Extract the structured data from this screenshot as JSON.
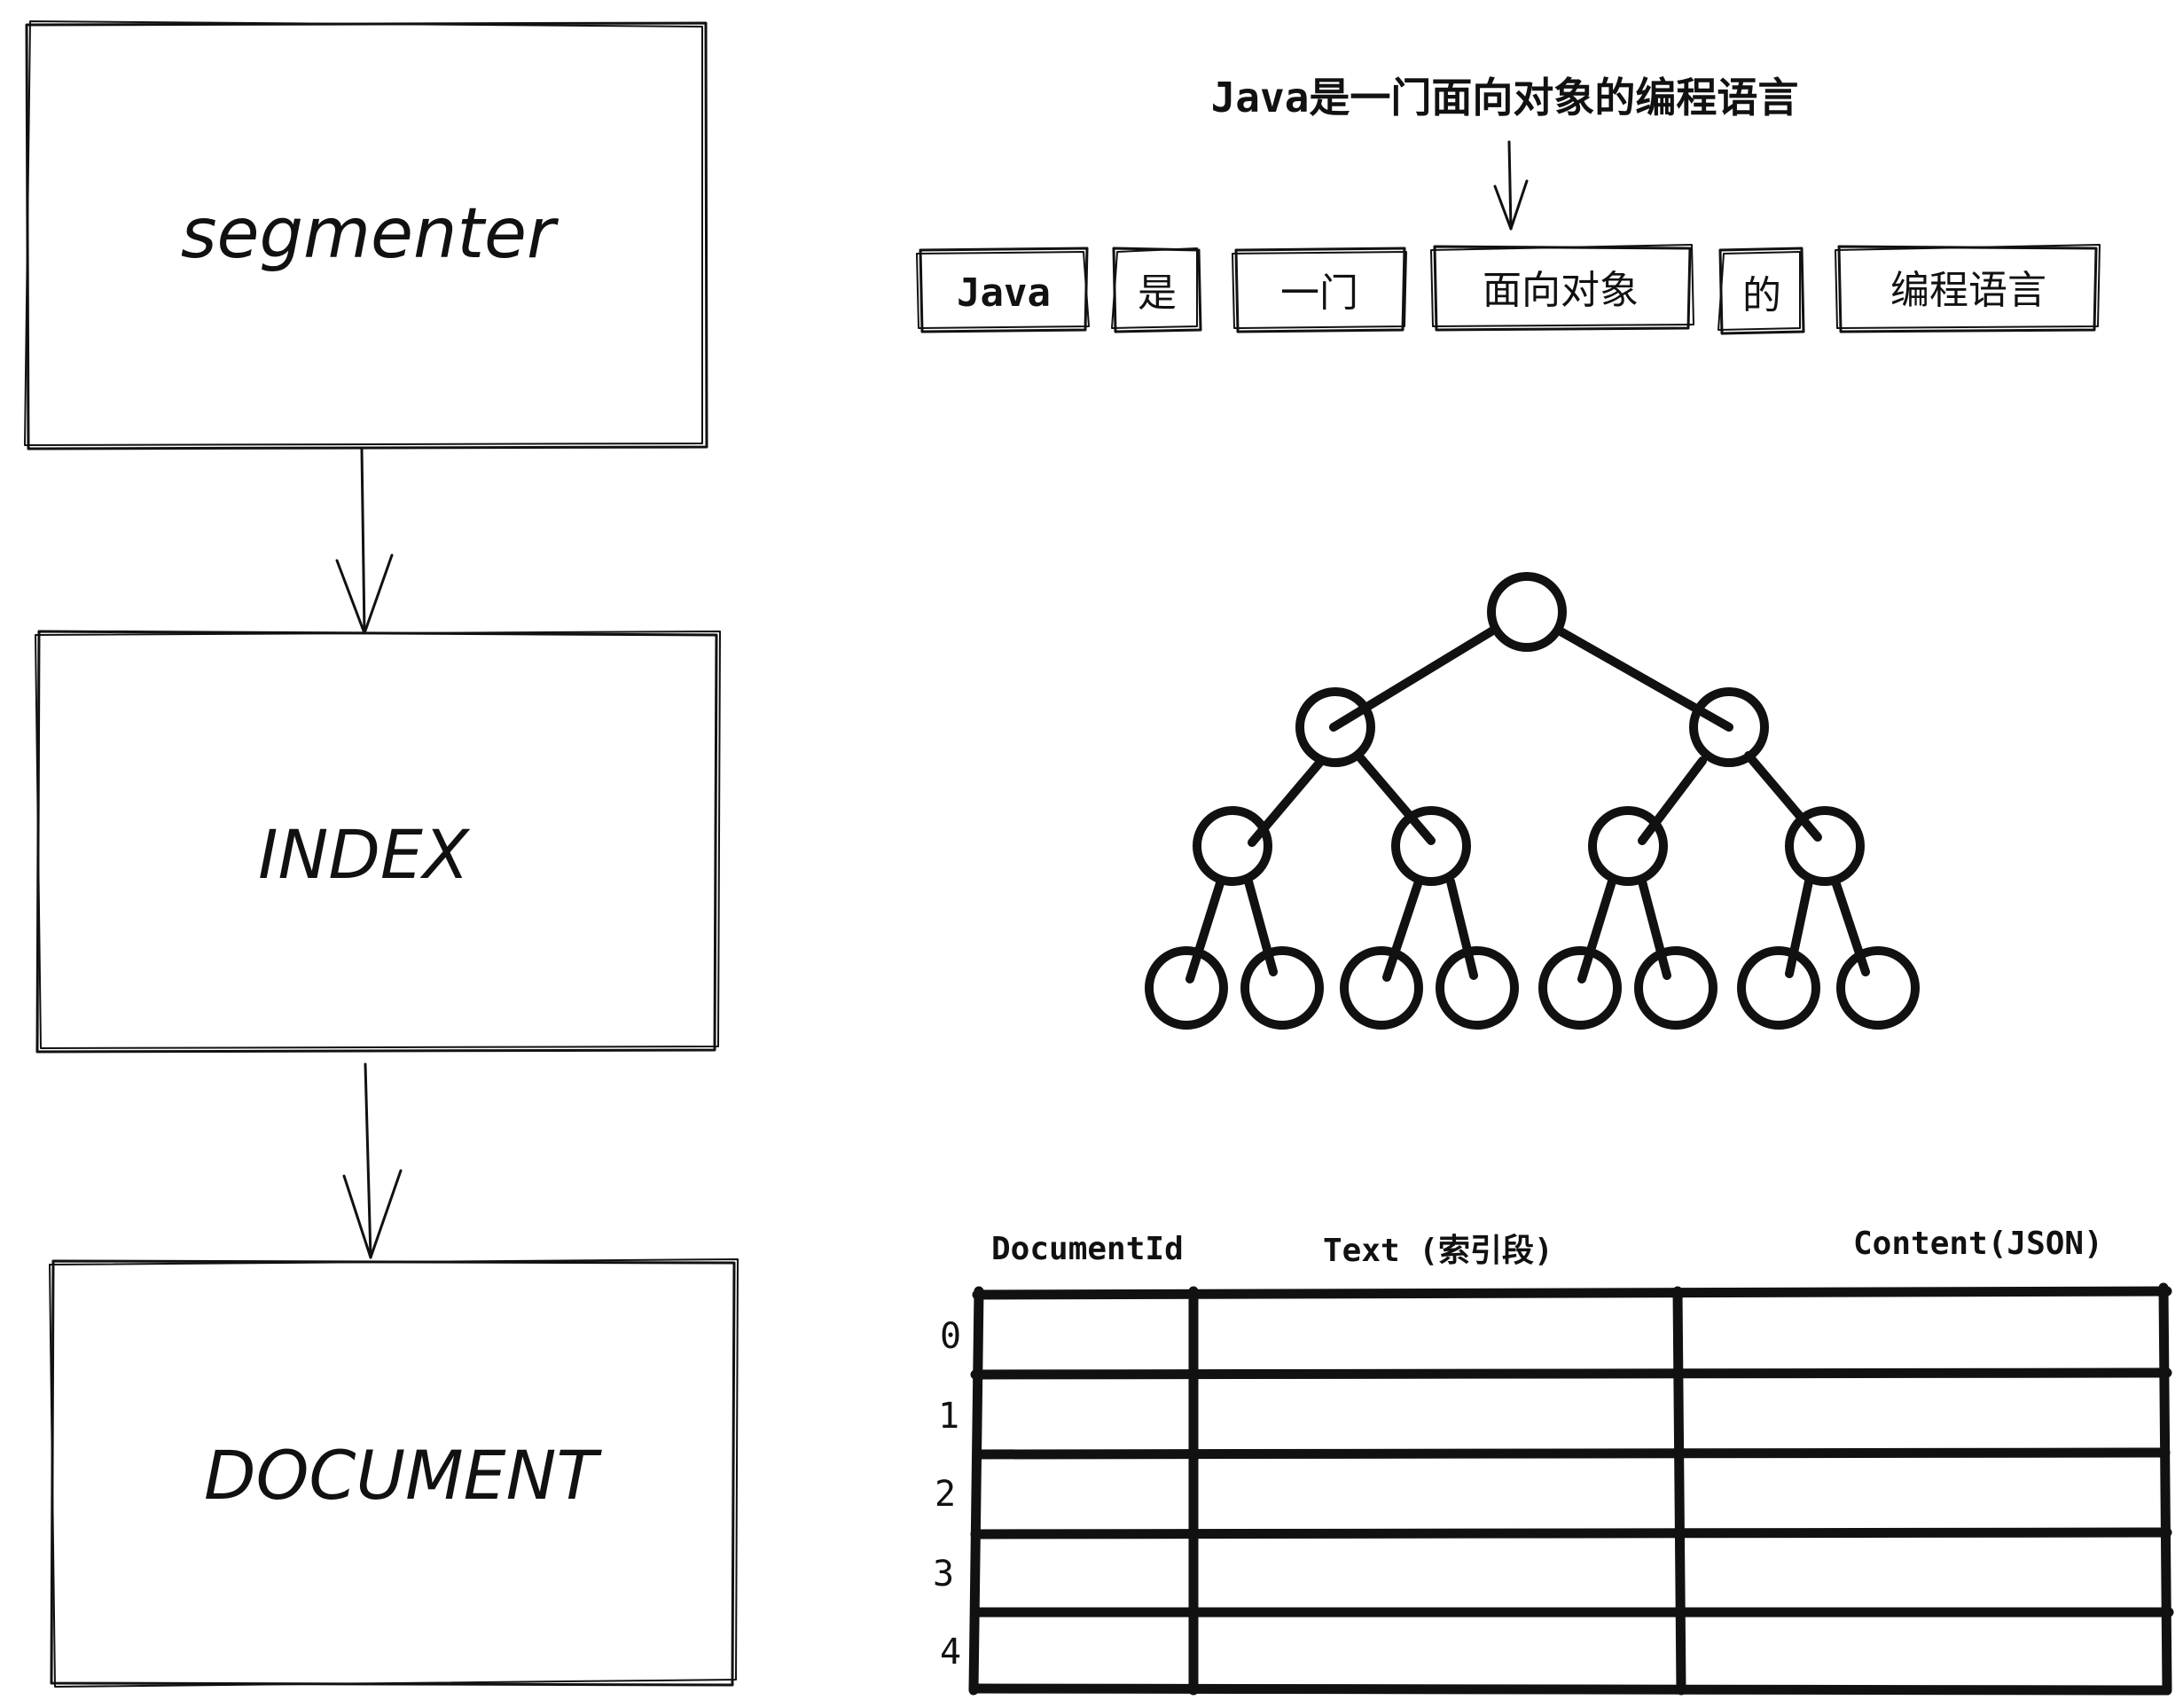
{
  "pipeline": {
    "boxes": [
      {
        "label": "segmenter"
      },
      {
        "label": "INDEX"
      },
      {
        "label": "DOCUMENT"
      }
    ]
  },
  "tokenization": {
    "sentence": "Java是一门面向对象的编程语言",
    "tokens": [
      "Java",
      "是",
      "一门",
      "面向对象",
      "的",
      "编程语言"
    ]
  },
  "table": {
    "headers": [
      "DocumentId",
      "Text (索引段)",
      "Content(JSON)"
    ],
    "row_ids": [
      "0",
      "1",
      "2",
      "3",
      "4"
    ]
  }
}
